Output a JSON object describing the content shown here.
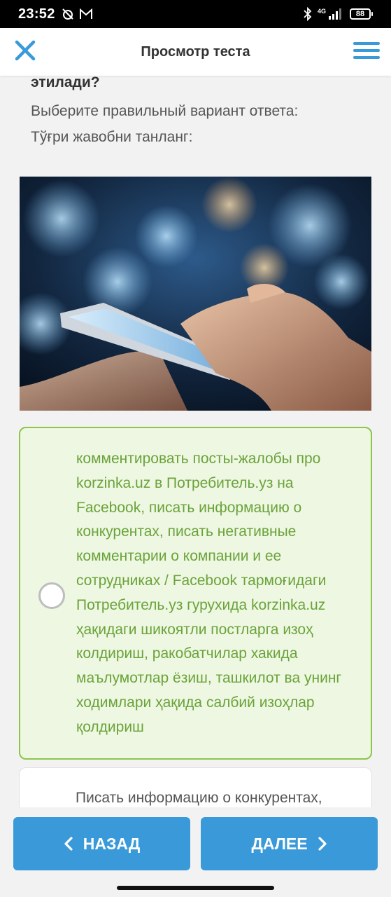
{
  "status_bar": {
    "time": "23:52",
    "network": "4G",
    "battery": "88"
  },
  "header": {
    "title": "Просмотр теста",
    "close_icon": "close-icon",
    "menu_icon": "hamburger-menu-icon",
    "accent_color": "#3a9ad9"
  },
  "question": {
    "tail": "этилади?",
    "instruction_ru": "Выберите правильный вариант ответа:",
    "instruction_uz": "Тўғри жавобни танланг:"
  },
  "options": [
    {
      "text": "комментировать посты-жалобы про korzinka.uz в Потребитель.уз на Facebook, писать информацию о конкурентах, писать негативные комментарии о компании и ее сотрудниках / Facebook тармоғидаги Потребитель.уз гурухида korzinka.uz ҳақидаги шикоятли постларга изоҳ колдириш, ракобатчилар хакида маълумотлар ёзиш, ташкилот ва унинг ходимлари ҳақида салбий изоҳлар қолдириш",
      "highlighted": true,
      "highlight_color": "#8cc64a"
    },
    {
      "text": "Писать информацию о конкурентах,",
      "highlighted": false
    }
  ],
  "nav": {
    "prev_label": "НАЗАД",
    "next_label": "ДАЛЕЕ",
    "prev_icon": "chevron-left-icon",
    "next_icon": "chevron-right-icon"
  }
}
